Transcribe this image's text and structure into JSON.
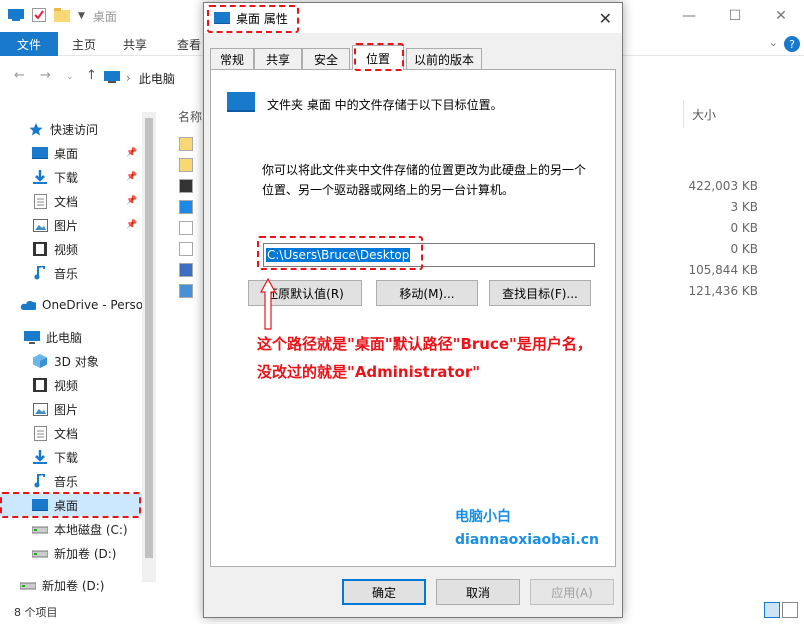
{
  "explorer": {
    "title": "桌面",
    "ribbon": {
      "file": "文件",
      "tabs": [
        "主页",
        "共享",
        "查看"
      ]
    },
    "breadcrumb": "此电脑",
    "column_name_partial": "名称",
    "column_size": "大小",
    "sizes": [
      "422,003 KB",
      "3 KB",
      "0 KB",
      "0 KB",
      "105,844 KB",
      "121,436 KB"
    ],
    "status": "8 个项目",
    "sidebar": [
      {
        "label": "快速访问",
        "icon": "star-icon"
      },
      {
        "label": "桌面",
        "icon": "desktop-icon",
        "pinned": true
      },
      {
        "label": "下载",
        "icon": "download-icon",
        "pinned": true
      },
      {
        "label": "文档",
        "icon": "document-icon",
        "pinned": true
      },
      {
        "label": "图片",
        "icon": "picture-icon",
        "pinned": true
      },
      {
        "label": "视频",
        "icon": "video-icon"
      },
      {
        "label": "音乐",
        "icon": "music-icon"
      },
      {
        "label": "OneDrive - Perso",
        "icon": "cloud-icon"
      },
      {
        "label": "此电脑",
        "icon": "computer-icon"
      },
      {
        "label": "3D 对象",
        "icon": "cube-icon"
      },
      {
        "label": "视频",
        "icon": "video-icon"
      },
      {
        "label": "图片",
        "icon": "picture-icon"
      },
      {
        "label": "文档",
        "icon": "document-icon"
      },
      {
        "label": "下载",
        "icon": "download-icon"
      },
      {
        "label": "音乐",
        "icon": "music-icon"
      },
      {
        "label": "桌面",
        "icon": "desktop-icon",
        "selected": true
      },
      {
        "label": "本地磁盘 (C:)",
        "icon": "drive-icon"
      },
      {
        "label": "新加卷 (D:)",
        "icon": "drive-icon"
      },
      {
        "label": "新加卷 (D:)",
        "icon": "drive-icon"
      }
    ]
  },
  "dialog": {
    "title": "桌面 属性",
    "tabs": [
      "常规",
      "共享",
      "安全",
      "位置",
      "以前的版本"
    ],
    "active_tab": "位置",
    "info_line": "文件夹 桌面 中的文件存储于以下目标位置。",
    "desc_line1": "你可以将此文件夹中文件存储的位置更改为此硬盘上的另一个",
    "desc_line2": "位置、另一个驱动器或网络上的另一台计算机。",
    "path_value": "C:\\Users\\Bruce\\Desktop",
    "restore_default": "还原默认值(R)",
    "move": "移动(M)...",
    "find_target": "查找目标(F)...",
    "ok": "确定",
    "cancel": "取消",
    "apply": "应用(A)"
  },
  "annotation": {
    "line1": "这个路径就是\"桌面\"默认路径\"Bruce\"是用户名，",
    "line2": "没改过的就是\"Administrator\""
  },
  "watermark": {
    "line1": "电脑小白",
    "line2": "diannaoxiaobai.cn"
  },
  "colors": {
    "accent": "#1979ca",
    "highlight_red": "#e8141a",
    "watermark_blue": "#1a8fe3"
  }
}
